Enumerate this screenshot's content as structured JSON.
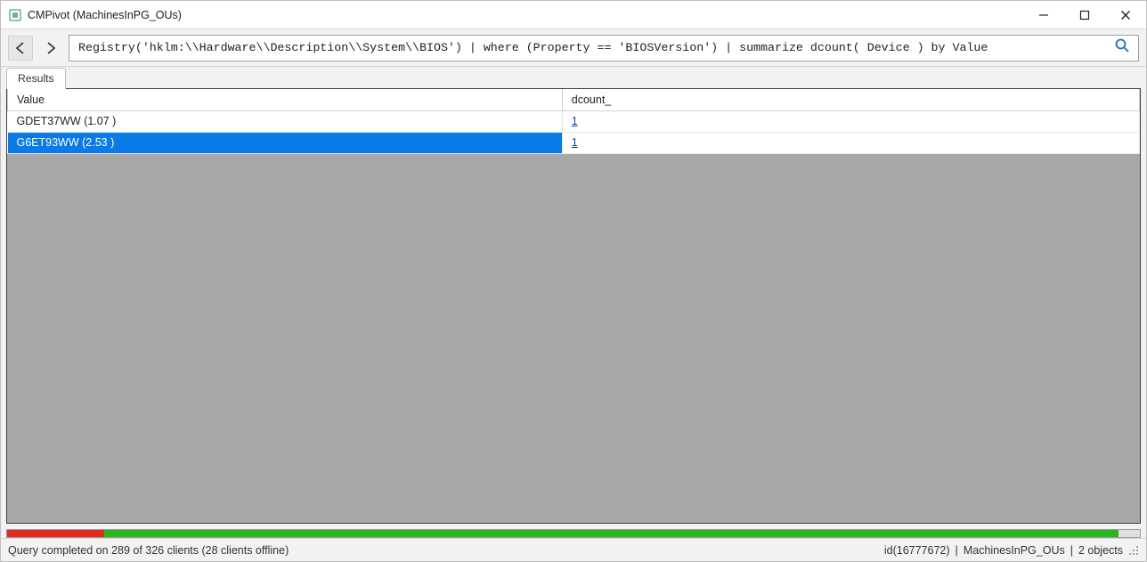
{
  "window": {
    "title": "CMPivot (MachinesInPG_OUs)"
  },
  "query": {
    "text": "Registry('hklm:\\\\Hardware\\\\Description\\\\System\\\\BIOS') | where (Property == 'BIOSVersion') | summarize dcount( Device ) by Value"
  },
  "tabs": [
    {
      "label": "Results"
    }
  ],
  "columns": [
    {
      "header": "Value"
    },
    {
      "header": "dcount_"
    }
  ],
  "rows": [
    {
      "value": "GDET37WW (1.07 )",
      "dcount": "1",
      "selected": false
    },
    {
      "value": "G6ET93WW (2.53 )",
      "dcount": "1",
      "selected": true
    }
  ],
  "progress": {
    "red_pct": 8.6,
    "green_pct": 89.5,
    "gray_pct": 1.9
  },
  "status": {
    "left": "Query completed on 289 of 326 clients (28 clients offline)",
    "id": "id(16777672)",
    "collection": "MachinesInPG_OUs",
    "objects": "2 objects"
  }
}
